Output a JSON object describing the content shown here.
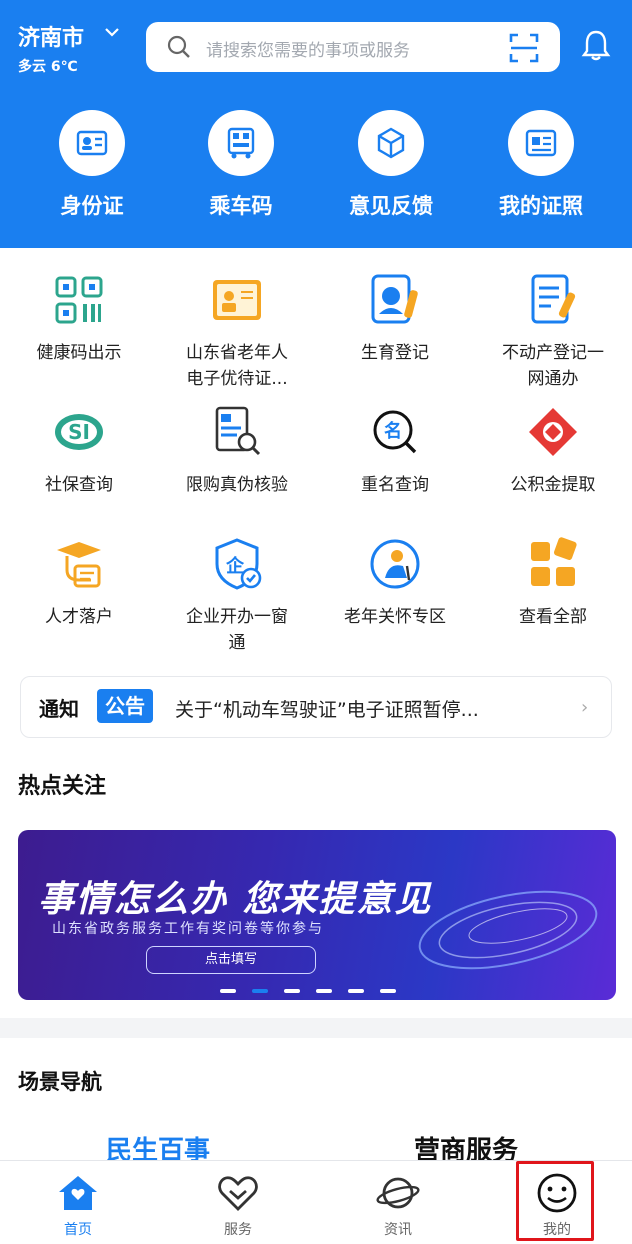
{
  "header": {
    "city": "济南市",
    "weather": "多云 6℃",
    "search_placeholder": "请搜索您需要的事项或服务",
    "quick": [
      {
        "label": "身份证",
        "icon": "id-card-icon"
      },
      {
        "label": "乘车码",
        "icon": "bus-code-icon"
      },
      {
        "label": "意见反馈",
        "icon": "feedback-cube-icon"
      },
      {
        "label": "我的证照",
        "icon": "license-icon"
      }
    ]
  },
  "services": [
    {
      "label": "健康码出示",
      "icon": "qr-code-icon"
    },
    {
      "label": "山东省老年人\n电子优待证...",
      "icon": "senior-card-icon"
    },
    {
      "label": "生育登记",
      "icon": "birth-register-icon"
    },
    {
      "label": "不动产登记一\n网通办",
      "icon": "property-doc-icon"
    },
    {
      "label": "社保查询",
      "icon": "social-security-icon"
    },
    {
      "label": "限购真伪核验",
      "icon": "verify-doc-icon"
    },
    {
      "label": "重名查询",
      "icon": "name-search-icon"
    },
    {
      "label": "公积金提取",
      "icon": "housing-fund-icon"
    },
    {
      "label": "人才落户",
      "icon": "graduate-icon"
    },
    {
      "label": "企业开办一窗\n通",
      "icon": "enterprise-shield-icon"
    },
    {
      "label": "老年关怀专区",
      "icon": "elder-care-icon"
    },
    {
      "label": "查看全部",
      "icon": "grid-all-icon"
    }
  ],
  "notice": {
    "tag1": "通知",
    "tag2": "公告",
    "text": "关于“机动车驾驶证”电子证照暂停...",
    "arrow": "›"
  },
  "hot": {
    "title": "热点关注",
    "banner_headline": "事情怎么办 您来提意见",
    "banner_sub": "山东省政务服务工作有奖问卷等你参与",
    "banner_button": "点击填写",
    "active_dot_index": 1,
    "dot_count": 6
  },
  "scene": {
    "title": "场景导航",
    "tabs": [
      "民生百事",
      "营商服务"
    ]
  },
  "nav": [
    {
      "label": "首页",
      "icon": "home-icon",
      "active": true
    },
    {
      "label": "服务",
      "icon": "heart-icon",
      "active": false
    },
    {
      "label": "资讯",
      "icon": "planet-icon",
      "active": false
    },
    {
      "label": "我的",
      "icon": "smiley-icon",
      "active": false
    }
  ],
  "colors": {
    "brand": "#1a7ff0",
    "orange": "#f5a623",
    "green": "#2ca58d",
    "red": "#e53935",
    "highlight": "#e0151b"
  }
}
